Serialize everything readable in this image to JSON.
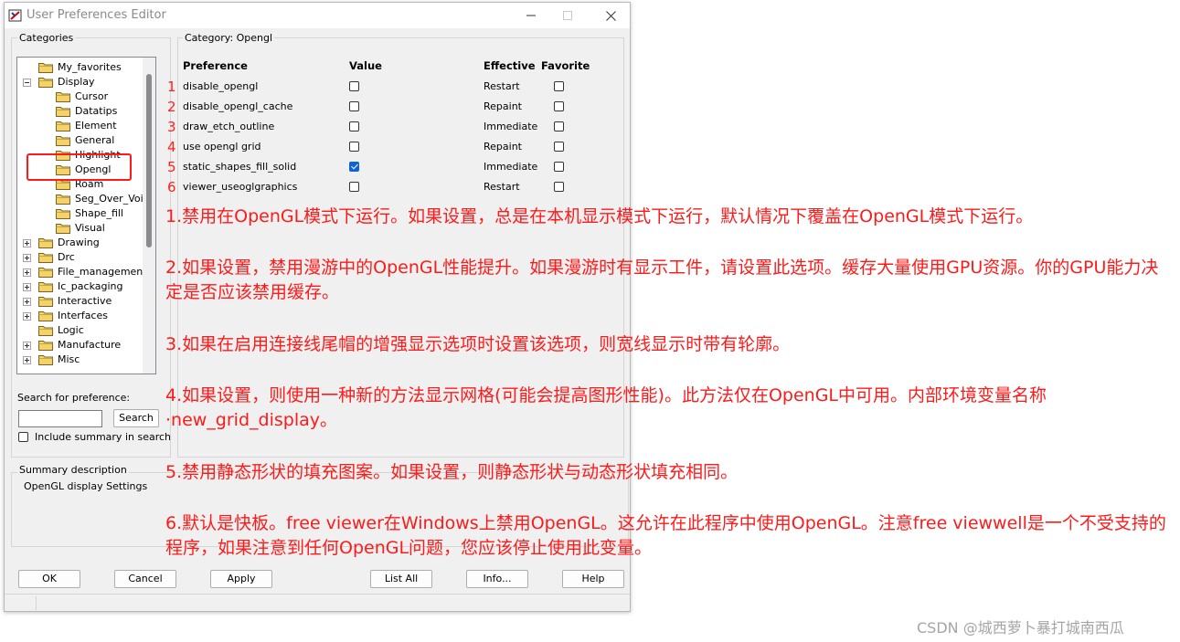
{
  "window": {
    "title": "User Preferences Editor"
  },
  "categories": {
    "title": "Categories",
    "tree": [
      {
        "label": "My_favorites",
        "level": 0,
        "expander": "none"
      },
      {
        "label": "Display",
        "level": 0,
        "expander": "minus"
      },
      {
        "label": "Cursor",
        "level": 1,
        "expander": "none"
      },
      {
        "label": "Datatips",
        "level": 1,
        "expander": "none"
      },
      {
        "label": "Element",
        "level": 1,
        "expander": "none"
      },
      {
        "label": "General",
        "level": 1,
        "expander": "none"
      },
      {
        "label": "Highlight",
        "level": 1,
        "expander": "none"
      },
      {
        "label": "Opengl",
        "level": 1,
        "expander": "none",
        "selected": true
      },
      {
        "label": "Roam",
        "level": 1,
        "expander": "none"
      },
      {
        "label": "Seg_Over_Voi",
        "level": 1,
        "expander": "none"
      },
      {
        "label": "Shape_fill",
        "level": 1,
        "expander": "none"
      },
      {
        "label": "Visual",
        "level": 1,
        "expander": "none"
      },
      {
        "label": "Drawing",
        "level": 0,
        "expander": "plus"
      },
      {
        "label": "Drc",
        "level": 0,
        "expander": "plus"
      },
      {
        "label": "File_management",
        "level": 0,
        "expander": "plus"
      },
      {
        "label": "Ic_packaging",
        "level": 0,
        "expander": "plus"
      },
      {
        "label": "Interactive",
        "level": 0,
        "expander": "plus"
      },
      {
        "label": "Interfaces",
        "level": 0,
        "expander": "plus"
      },
      {
        "label": "Logic",
        "level": 0,
        "expander": "none"
      },
      {
        "label": "Manufacture",
        "level": 0,
        "expander": "plus"
      },
      {
        "label": "Misc",
        "level": 0,
        "expander": "plus"
      }
    ]
  },
  "search": {
    "label": "Search for preference:",
    "button": "Search",
    "include_summary": "Include summary in search",
    "value": ""
  },
  "summary": {
    "title": "Summary description",
    "text": "OpenGL display Settings"
  },
  "category_panel": {
    "title": "Category:  Opengl",
    "headers": {
      "preference": "Preference",
      "value": "Value",
      "effective": "Effective",
      "favorite": "Favorite"
    },
    "rows": [
      {
        "num": "1",
        "name": "disable_opengl",
        "checked": false,
        "effective": "Restart"
      },
      {
        "num": "2",
        "name": "disable_opengl_cache",
        "checked": false,
        "effective": "Repaint"
      },
      {
        "num": "3",
        "name": "draw_etch_outline",
        "checked": false,
        "effective": "Immediate"
      },
      {
        "num": "4",
        "name": "use opengl grid",
        "checked": false,
        "effective": "Repaint"
      },
      {
        "num": "5",
        "name": "static_shapes_fill_solid",
        "checked": true,
        "effective": "Immediate"
      },
      {
        "num": "6",
        "name": "viewer_useoglgraphics",
        "checked": false,
        "effective": "Restart"
      }
    ]
  },
  "buttons": {
    "ok": "OK",
    "cancel": "Cancel",
    "apply": "Apply",
    "list_all": "List All",
    "info": "Info...",
    "help": "Help"
  },
  "notes": [
    "1.禁用在OpenGL模式下运行。如果设置，总是在本机显示模式下运行，默认情况下覆盖在OpenGL模式下运行。",
    "2.如果设置，禁用漫游中的OpenGL性能提升。如果漫游时有显示工件，请设置此选项。缓存大量使用GPU资源。你的GPU能力决定是否应该禁用缓存。",
    "3.如果在启用连接线尾帽的增强显示选项时设置该选项，则宽线显示时带有轮廓。",
    "4.如果设置，则使用一种新的方法显示网格(可能会提高图形性能)。此方法仅在OpenGL中可用。内部环境变量名称·new_grid_display。",
    "5.禁用静态形状的填充图案。如果设置，则静态形状与动态形状填充相同。",
    "6.默认是快板。free viewer在Windows上禁用OpenGL。这允许在此程序中使用OpenGL。注意free viewwell是一个不受支持的程序，如果注意到任何OpenGL问题，您应该停止使用此变量。"
  ],
  "watermark": "CSDN @城西萝卜暴打城南西瓜",
  "colors": {
    "annotation": "#ff1a1a",
    "checkbox_checked": "#0f64d2"
  }
}
